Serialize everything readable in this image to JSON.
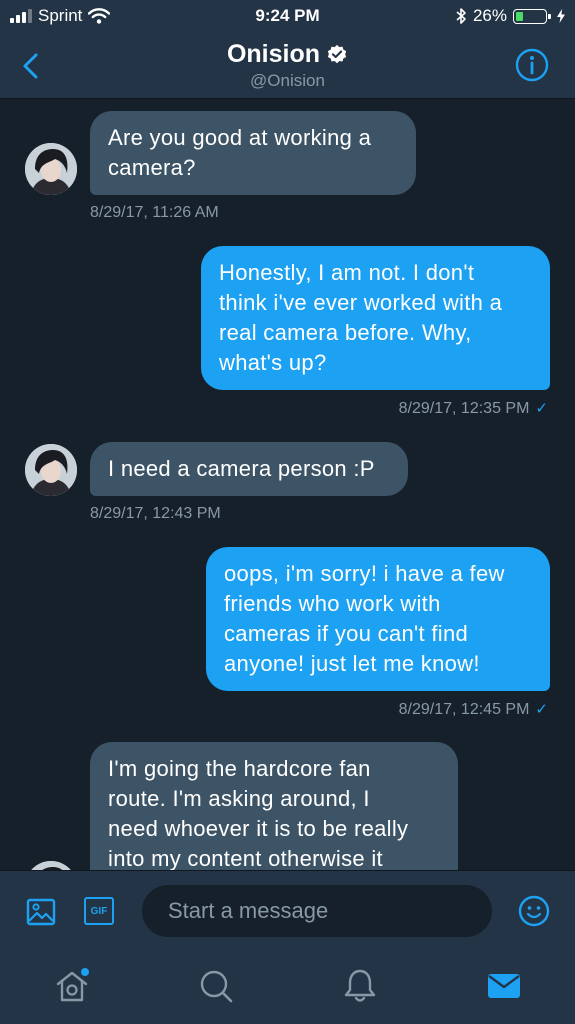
{
  "status_bar": {
    "carrier": "Sprint",
    "time": "9:24 PM",
    "battery_percent": "26%",
    "battery_level": 0.26
  },
  "header": {
    "name": "Onision",
    "handle": "@Onision",
    "icons": {
      "back": "chevron-left-icon",
      "verified": "verified-badge-icon",
      "info": "info-icon"
    }
  },
  "messages": [
    {
      "direction": "in",
      "lines": [
        "Are you good at working a",
        "camera?"
      ],
      "timestamp": "8/29/17, 11:26 AM"
    },
    {
      "direction": "out",
      "lines": [
        "Honestly, I am not. I don't",
        "think i've ever worked with a",
        "real camera before. Why,",
        "what's up?"
      ],
      "timestamp": "8/29/17, 12:35 PM"
    },
    {
      "direction": "in",
      "lines": [
        "I need a camera person :P"
      ],
      "timestamp": "8/29/17, 12:43 PM"
    },
    {
      "direction": "out",
      "lines": [
        "oops, i'm sorry! i have a few",
        "friends who work with",
        "cameras if you can't find",
        "anyone! just let me know!"
      ],
      "timestamp": "8/29/17, 12:45 PM"
    },
    {
      "direction": "in",
      "lines": [
        "I'm going the hardcore fan",
        "route. I'm asking around, I",
        "need whoever it is to be really",
        "into my content otherwise it"
      ]
    }
  ],
  "composer": {
    "placeholder": "Start a message",
    "gif_label": "GIF",
    "icons": {
      "photo": "image-icon",
      "gif": "gif-icon",
      "emoji": "emoji-icon"
    }
  },
  "tabs": [
    {
      "id": "home",
      "icon": "home-icon",
      "notification_dot": true
    },
    {
      "id": "search",
      "icon": "search-icon"
    },
    {
      "id": "notifications",
      "icon": "bell-icon"
    },
    {
      "id": "messages",
      "icon": "envelope-icon",
      "active": true
    }
  ],
  "colors": {
    "background": "#15202b",
    "bar": "#243447",
    "accent": "#1da1f2",
    "incoming_bubble": "#3d5466",
    "muted_text": "#8899a6"
  }
}
